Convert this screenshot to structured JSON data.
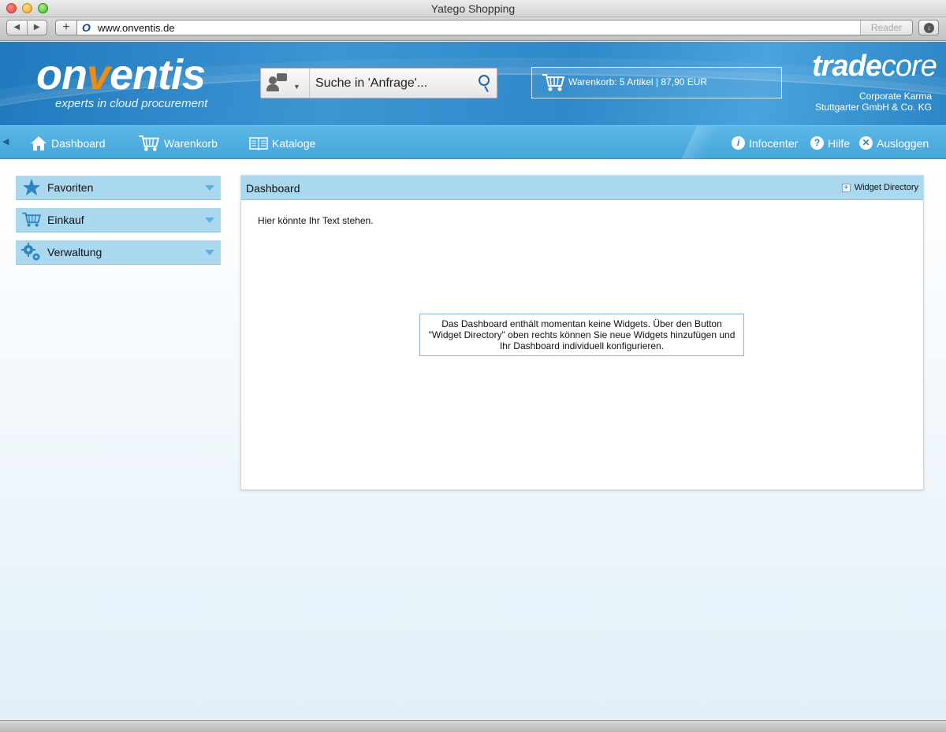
{
  "window": {
    "title": "Yatego Shopping"
  },
  "browser": {
    "url": "www.onventis.de",
    "reader_label": "Reader"
  },
  "header": {
    "logo_main_1": "on",
    "logo_main_v": "v",
    "logo_main_2": "entis",
    "tagline": "experts in cloud procurement",
    "search_placeholder": "Suche  in 'Anfrage'...",
    "cart_text": "Warenkorb: 5 Artikel | 87,90 EUR",
    "brand_bold": "trade",
    "brand_light": "core",
    "company_line1": "Corporate Karma",
    "company_line2": "Stuttgarter GmbH & Co. KG"
  },
  "nav": {
    "dashboard": "Dashboard",
    "warenkorb": "Warenkorb",
    "kataloge": "Kataloge",
    "infocenter": "Infocenter",
    "hilfe": "Hilfe",
    "ausloggen": "Ausloggen"
  },
  "sidebar": {
    "items": [
      {
        "label": "Favoriten",
        "icon": "star-icon"
      },
      {
        "label": "Einkauf",
        "icon": "cart-icon"
      },
      {
        "label": "Verwaltung",
        "icon": "gears-icon"
      }
    ]
  },
  "dashboard": {
    "title": "Dashboard",
    "widget_directory": "Widget Directory",
    "intro_text": "Hier könnte Ihr Text stehen.",
    "notice_line1": "Das Dashboard enthält momentan keine Widgets. Über den Button",
    "notice_line2": "\"Widget Directory\" oben rechts können Sie neue Widgets hinzufügen und",
    "notice_line3": "Ihr Dashboard individuell konfigurieren."
  },
  "colors": {
    "accent": "#44a6db",
    "panel_header": "#a9d8ef",
    "logo_orange": "#f08a14"
  }
}
